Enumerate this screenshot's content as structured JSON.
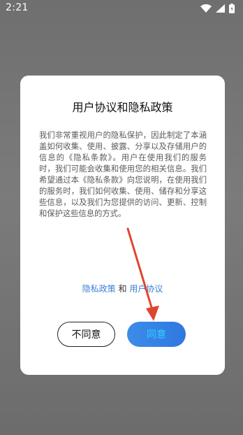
{
  "status_bar": {
    "time": "2:21",
    "icons": [
      "wifi-icon",
      "signal-icon",
      "battery-icon"
    ]
  },
  "dialog": {
    "title": "用户协议和隐私政策",
    "body": "我们非常重视用户的隐私保护，因此制定了本涵盖如何收集、使用、披露、分享以及存储用户的信息的《隐私条款》。用户在使用我们的服务时，我们可能会收集和使用您的相关信息。我们希望通过本《隐私条款》向您说明，在使用我们的服务时，我们如何收集、使用、储存和分享这些信息，以及我们为您提供的访问、更新、控制和保护这些信息的方式。",
    "links": {
      "privacy_policy": "隐私政策",
      "conjunction": " 和 ",
      "user_agreement": "用户协议"
    },
    "buttons": {
      "decline": "不同意",
      "agree": "同意"
    }
  },
  "annotation": {
    "arrow_color": "#e0452f"
  },
  "colors": {
    "link": "#3d7fd6",
    "agree_button": "#3c8ce8",
    "overlay": "#707070"
  }
}
